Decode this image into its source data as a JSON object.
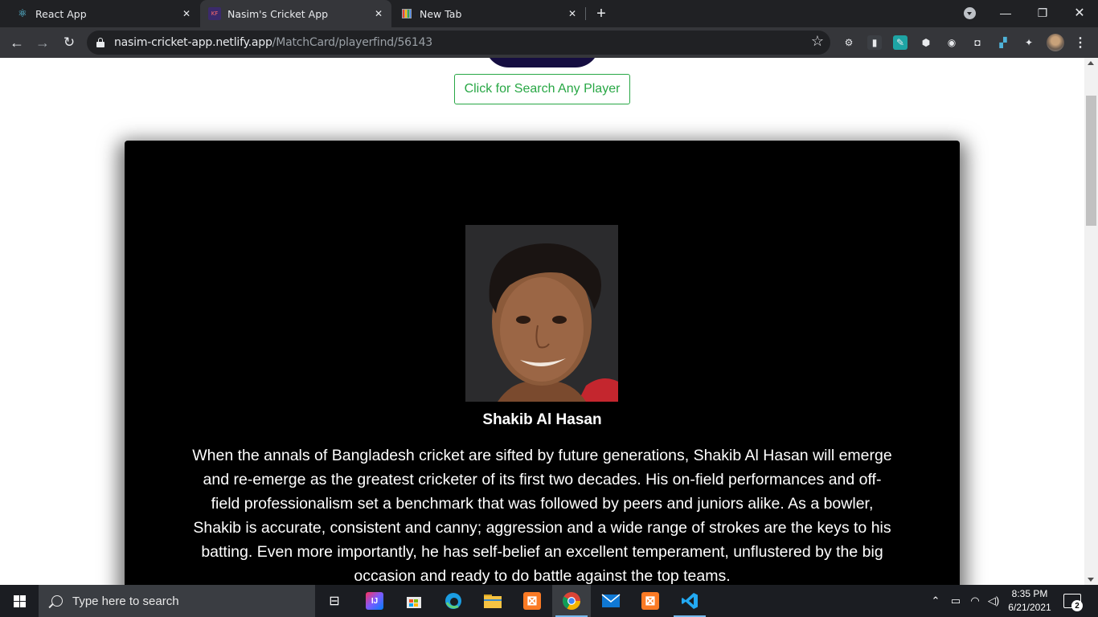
{
  "browser": {
    "tabs": [
      {
        "title": "React App",
        "icon": "react-icon",
        "active": false
      },
      {
        "title": "Nasim's Cricket App",
        "icon": "cricket-app-icon",
        "active": true
      },
      {
        "title": "New Tab",
        "icon": "newtab-icon",
        "active": false
      }
    ],
    "url_host": "nasim-cricket-app.netlify.app",
    "url_path": "/MatchCard/playerfind/56143"
  },
  "page": {
    "search_button_label": "Click for Search Any Player",
    "player": {
      "name": "Shakib Al Hasan",
      "bio": "When the annals of Bangladesh cricket are sifted by future generations, Shakib Al Hasan will emerge and re-emerge as the greatest cricketer of its first two decades. His on-field performances and off-field professionalism set a benchmark that was followed by peers and juniors alike. As a bowler, Shakib is accurate, consistent and canny; aggression and a wide range of strokes are the keys to his batting. Even more importantly, he has self-belief an excellent temperament, unflustered by the big occasion and ready to do battle against the top teams."
    }
  },
  "taskbar": {
    "search_placeholder": "Type here to search",
    "time": "8:35 PM",
    "date": "6/21/2021",
    "notification_count": "2"
  },
  "colors": {
    "button_accent": "#28a745",
    "card_bg": "#000000",
    "pill": "#150d40"
  }
}
